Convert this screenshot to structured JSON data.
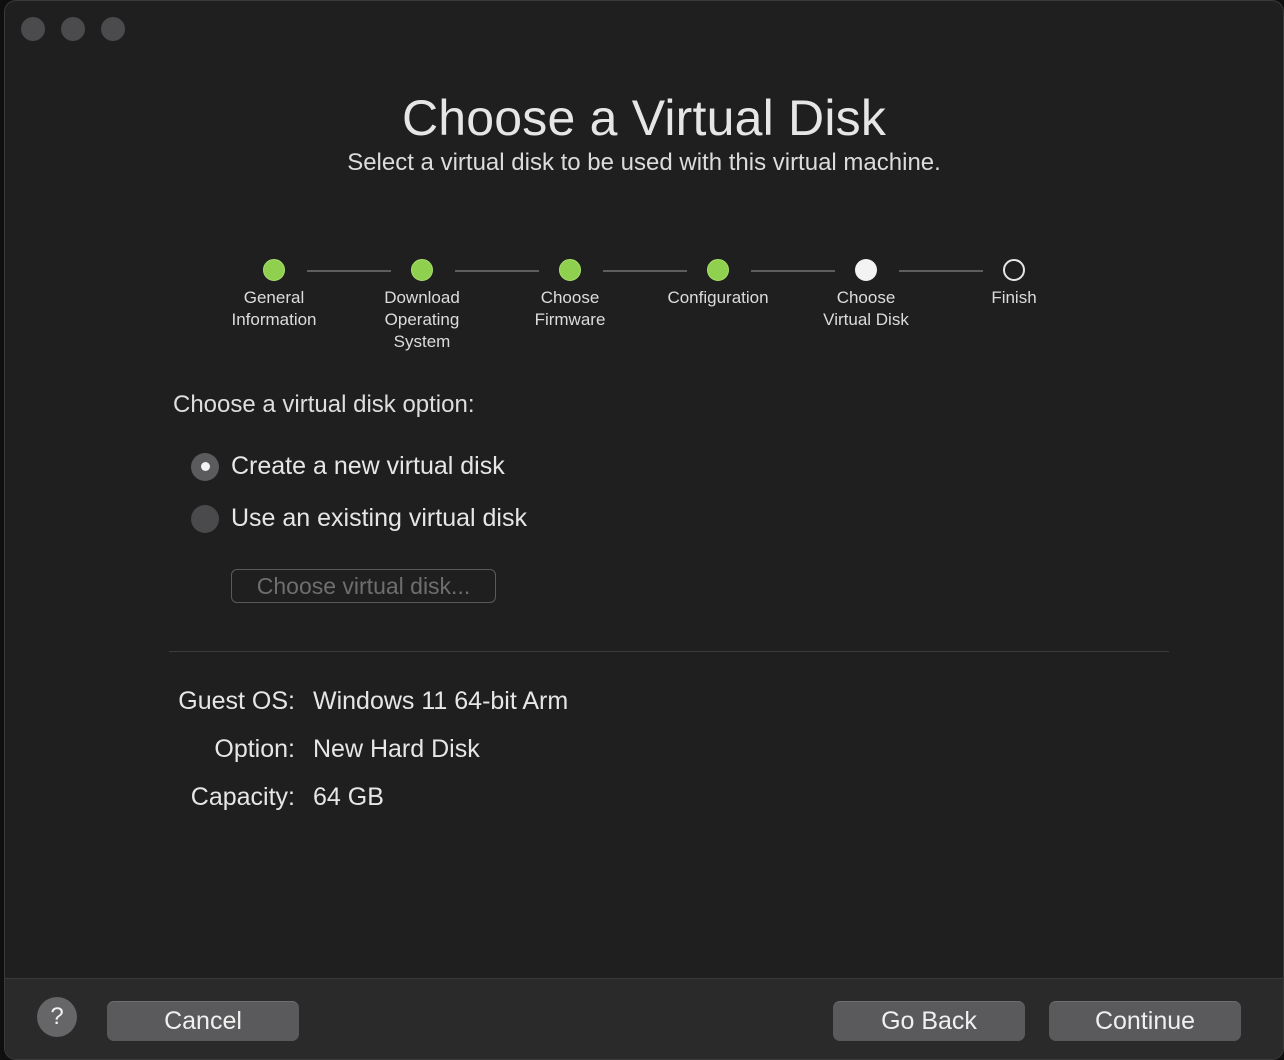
{
  "window": {
    "title": "Choose a Virtual Disk",
    "subtitle": "Select a virtual disk to be used with this virtual machine."
  },
  "steps": [
    {
      "label": "General\nInformation",
      "state": "done"
    },
    {
      "label": "Download\nOperating\nSystem",
      "state": "done"
    },
    {
      "label": "Choose\nFirmware",
      "state": "done"
    },
    {
      "label": "Configuration",
      "state": "done"
    },
    {
      "label": "Choose\nVirtual Disk",
      "state": "current"
    },
    {
      "label": "Finish",
      "state": "todo"
    }
  ],
  "disk_option": {
    "heading": "Choose a virtual disk option:",
    "options": [
      {
        "label": "Create a new virtual disk",
        "selected": true
      },
      {
        "label": "Use an existing virtual disk",
        "selected": false
      }
    ],
    "choose_button": "Choose virtual disk..."
  },
  "summary": [
    {
      "key": "Guest OS:",
      "value": "Windows 11 64-bit Arm"
    },
    {
      "key": "Option:",
      "value": "New Hard Disk"
    },
    {
      "key": "Capacity:",
      "value": "64 GB"
    }
  ],
  "footer": {
    "help": "?",
    "cancel": "Cancel",
    "go_back": "Go Back",
    "continue": "Continue"
  },
  "colors": {
    "done": "#8fd14f",
    "current": "#f3f3f3",
    "background": "#1f1f1f"
  }
}
